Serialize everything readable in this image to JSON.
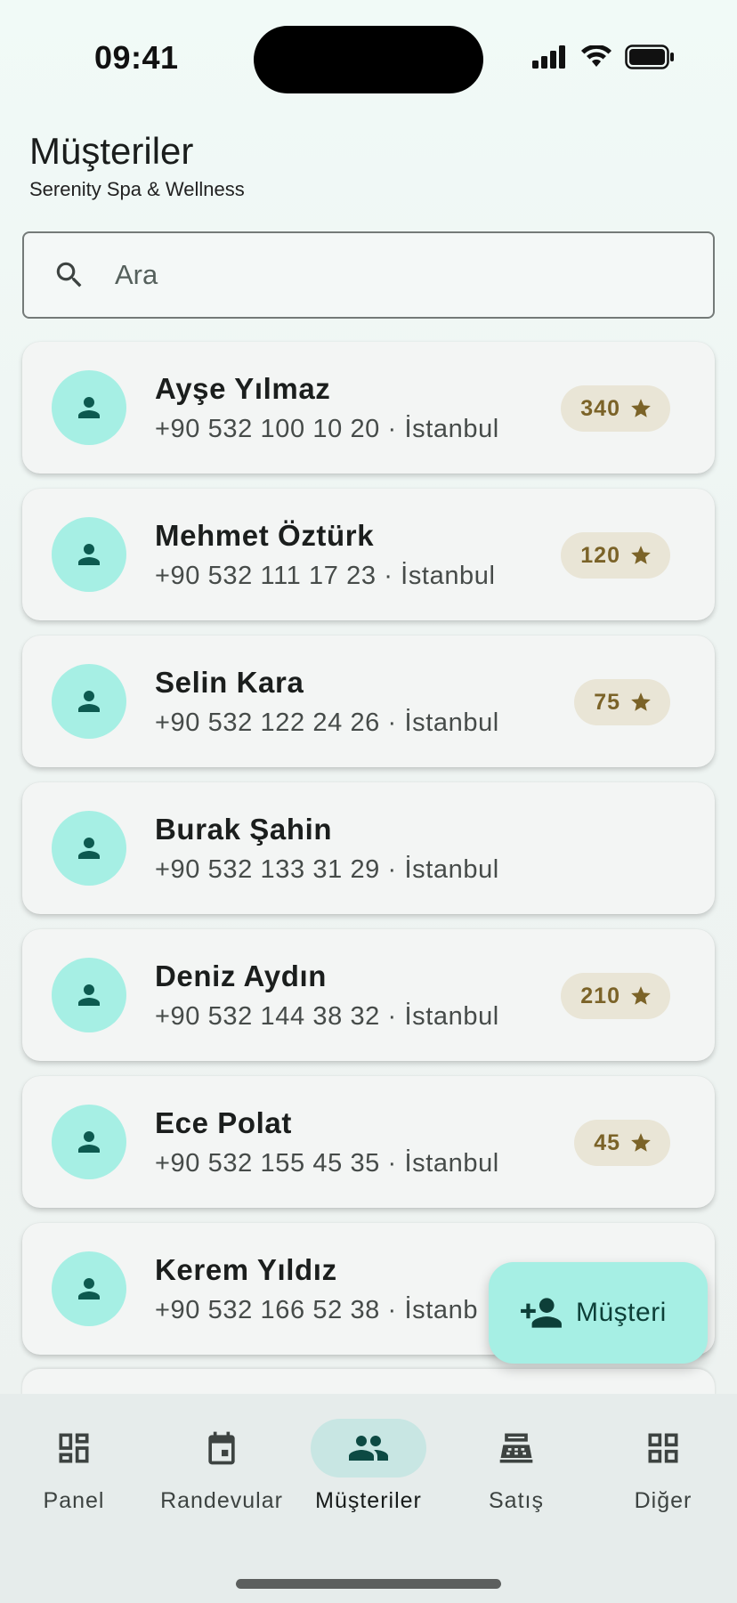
{
  "status_bar": {
    "time": "09:41"
  },
  "header": {
    "title": "Müşteriler",
    "subtitle": "Serenity Spa & Wellness"
  },
  "search": {
    "placeholder": "Ara",
    "value": ""
  },
  "customers": [
    {
      "name": "Ayşe Yılmaz",
      "meta": "+90 532 100 10 20 · İstanbul",
      "points": "340"
    },
    {
      "name": "Mehmet Öztürk",
      "meta": "+90 532 111 17 23 · İstanbul",
      "points": "120"
    },
    {
      "name": "Selin Kara",
      "meta": "+90 532 122 24 26 · İstanbul",
      "points": "75"
    },
    {
      "name": "Burak Şahin",
      "meta": "+90 532 133 31 29 · İstanbul",
      "points": null
    },
    {
      "name": "Deniz Aydın",
      "meta": "+90 532 144 38 32 · İstanbul",
      "points": "210"
    },
    {
      "name": "Ece Polat",
      "meta": "+90 532 155 45 35 · İstanbul",
      "points": "45"
    },
    {
      "name": "Kerem Yıldız",
      "meta": "+90 532 166 52 38 · İstanb",
      "points": null
    }
  ],
  "fab": {
    "label": "Müşteri",
    "icon": "person-add-icon"
  },
  "nav": {
    "items": [
      {
        "label": "Panel",
        "icon": "dashboard-icon"
      },
      {
        "label": "Randevular",
        "icon": "calendar-icon"
      },
      {
        "label": "Müşteriler",
        "icon": "people-icon",
        "active": true
      },
      {
        "label": "Satış",
        "icon": "cash-register-icon"
      },
      {
        "label": "Diğer",
        "icon": "grid-icon"
      }
    ]
  },
  "colors": {
    "accent": "#a6efe4",
    "accent_dark": "#0d5a50",
    "badge_bg": "#e9e5d6",
    "badge_text": "#7b6328"
  }
}
